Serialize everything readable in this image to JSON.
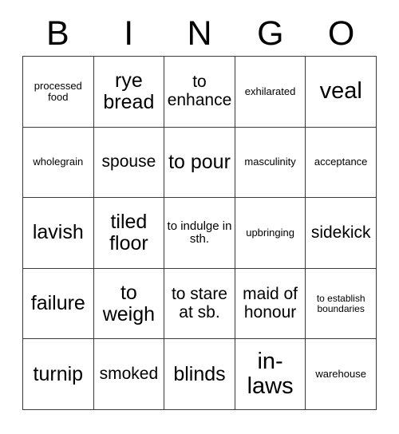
{
  "card": {
    "header": {
      "letters": [
        "B",
        "I",
        "N",
        "G",
        "O"
      ]
    },
    "colors": {
      "text": "#000000",
      "border": "#3a3a3a",
      "background": "#ffffff"
    },
    "grid": {
      "columns": 5,
      "rows": 5,
      "cells": [
        [
          {
            "label": "processed food",
            "size": "xs"
          },
          {
            "label": "rye bread",
            "size": "lg"
          },
          {
            "label": "to enhance",
            "size": "md"
          },
          {
            "label": "exhilarated",
            "size": "xs"
          },
          {
            "label": "veal",
            "size": "xl"
          }
        ],
        [
          {
            "label": "wholegrain",
            "size": "xs"
          },
          {
            "label": "spouse",
            "size": "md"
          },
          {
            "label": "to pour",
            "size": "lg"
          },
          {
            "label": "masculinity",
            "size": "xs"
          },
          {
            "label": "acceptance",
            "size": "xs"
          }
        ],
        [
          {
            "label": "lavish",
            "size": "lg"
          },
          {
            "label": "tiled floor",
            "size": "lg"
          },
          {
            "label": "to indulge in sth.",
            "size": "sm"
          },
          {
            "label": "upbringing",
            "size": "xs"
          },
          {
            "label": "sidekick",
            "size": "md"
          }
        ],
        [
          {
            "label": "failure",
            "size": "lg"
          },
          {
            "label": "to weigh",
            "size": "lg"
          },
          {
            "label": "to stare at sb.",
            "size": "md"
          },
          {
            "label": "maid of honour",
            "size": "md"
          },
          {
            "label": "to establish boundaries",
            "size": "xxs"
          }
        ],
        [
          {
            "label": "turnip",
            "size": "lg"
          },
          {
            "label": "smoked",
            "size": "md"
          },
          {
            "label": "blinds",
            "size": "lg"
          },
          {
            "label": "in-laws",
            "size": "xl"
          },
          {
            "label": "warehouse",
            "size": "xs"
          }
        ]
      ]
    }
  }
}
